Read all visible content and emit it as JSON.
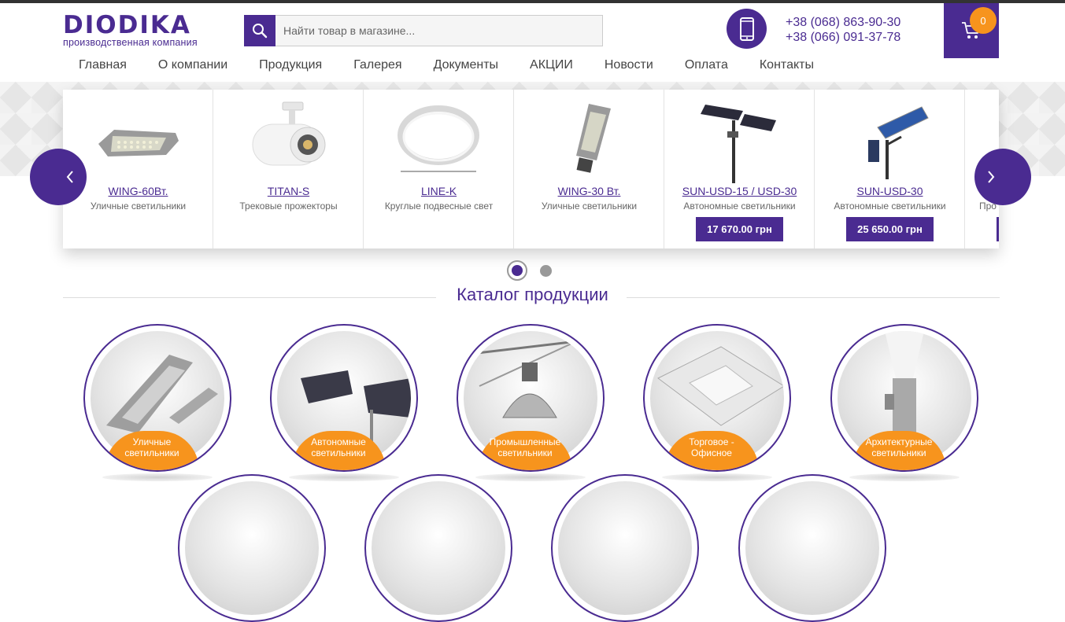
{
  "brand": {
    "name": "DIODIKA",
    "tagline": "производственная компания"
  },
  "search": {
    "placeholder": "Найти товар в магазине..."
  },
  "contacts": {
    "phone1": "+38 (068) 863-90-30",
    "phone2": "+38 (066) 091-37-78"
  },
  "cart": {
    "count": "0"
  },
  "nav": {
    "items": [
      "Главная",
      "О компании",
      "Продукция",
      "Галерея",
      "Документы",
      "АКЦИИ",
      "Новости",
      "Оплата",
      "Контакты"
    ]
  },
  "slider": {
    "items": [
      {
        "name": "WING-60Вт.",
        "category": "Уличные светильники",
        "price": ""
      },
      {
        "name": "TITAN-S",
        "category": "Трековые прожекторы",
        "price": ""
      },
      {
        "name": "LINE-K",
        "category": "Круглые подвесные свет",
        "price": ""
      },
      {
        "name": "WING-30 Вт.",
        "category": "Уличные светильники",
        "price": ""
      },
      {
        "name": "SUN-USD-15 / USD-30",
        "category": "Автономные светильники",
        "price": "17 670.00 грн"
      },
      {
        "name": "SUN-USD-30",
        "category": "Автономные светильники",
        "price": "25 650.00 грн"
      },
      {
        "name": "",
        "category": "Про",
        "price": ""
      }
    ],
    "pages": 2,
    "active_page": 1
  },
  "catalog": {
    "title": "Каталог продукции",
    "categories": [
      {
        "label1": "Уличные",
        "label2": "светильники"
      },
      {
        "label1": "Автономные",
        "label2": "светильники"
      },
      {
        "label1": "Промышленные",
        "label2": "светильники"
      },
      {
        "label1": "Торговое -",
        "label2": "Офисное"
      },
      {
        "label1": "Архитектурные",
        "label2": "светильники"
      }
    ]
  },
  "colors": {
    "brand": "#4a2b91",
    "accent": "#f7941d"
  },
  "icons": [
    "search-icon",
    "phone-icon",
    "cart-icon",
    "chevron-left-icon",
    "chevron-right-icon"
  ]
}
